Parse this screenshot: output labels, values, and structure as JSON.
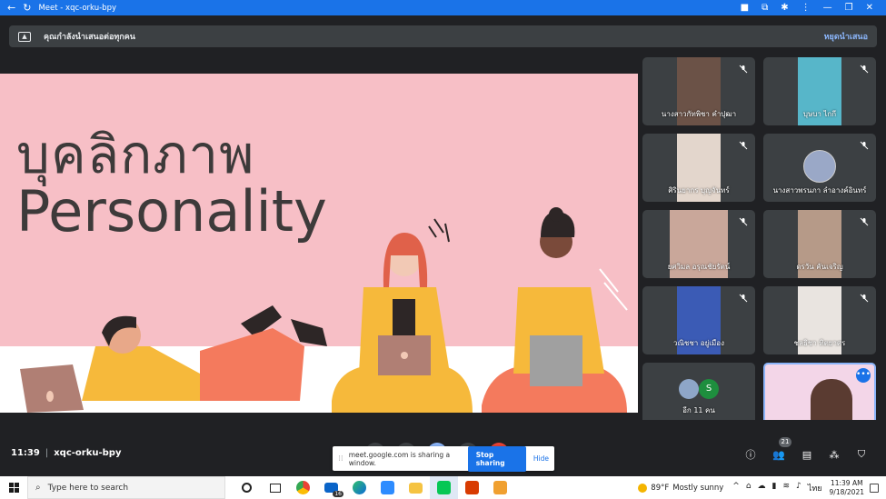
{
  "browser": {
    "title": "Meet - xqc-orku-bpy"
  },
  "present_banner": {
    "text": "คุณกำลังนำเสนอต่อทุกคน",
    "stop_label": "หยุดนำเสนอ"
  },
  "slide": {
    "title_thai": "บุคลิกภาพ",
    "title_en": "Personality"
  },
  "participants": [
    {
      "name": "นางสาวกัทพิชา คำปุฒา"
    },
    {
      "name": "บุษบา ไกกี"
    },
    {
      "name": "ศิรินยากร บุญจันทร์"
    },
    {
      "name": "นางสาวพรนภา ลำอางค์อินทร์"
    },
    {
      "name": "ยศวิมล อรุณชัยรัตน์"
    },
    {
      "name": "ดรวัน คันเจริญ"
    },
    {
      "name": "วณิชชา อยู่เมือง"
    },
    {
      "name": "ชลธิชา ทิตยาศร"
    }
  ],
  "more_tile": {
    "label": "อีก 11 คน",
    "avatar_letter": "S"
  },
  "meeting": {
    "time": "11:39",
    "code": "xqc-orku-bpy",
    "people_count": "21"
  },
  "share_popup": {
    "message": "meet.google.com is sharing a window.",
    "stop_label": "Stop sharing",
    "hide_label": "Hide"
  },
  "taskbar": {
    "search_placeholder": "Type here to search",
    "mail_badge": "16",
    "weather_temp": "89°F",
    "weather_desc": "Mostly sunny",
    "language": "ไทย",
    "clock_time": "11:39 AM",
    "clock_date": "9/18/2021"
  },
  "colors": {
    "accent": "#1a73e8",
    "slide_bg": "#f7bfc6",
    "meet_bg": "#202124"
  }
}
